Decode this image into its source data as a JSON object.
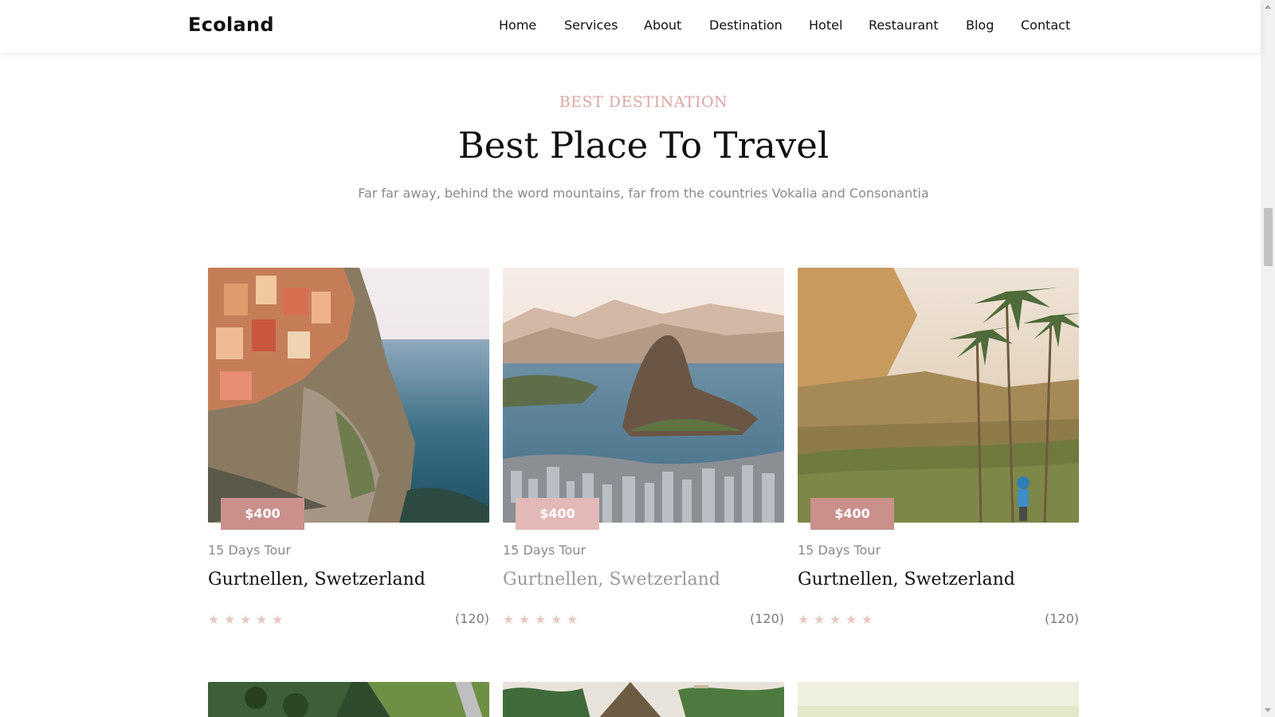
{
  "brand": "Ecoland",
  "nav": [
    "Home",
    "Services",
    "About",
    "Destination",
    "Hotel",
    "Restaurant",
    "Blog",
    "Contact"
  ],
  "section": {
    "subheading": "BEST DESTINATION",
    "title": "Best Place To Travel",
    "lead": "Far far away, behind the word mountains, far from the countries Vokalia and Consonantia"
  },
  "cards": [
    {
      "price": "$400",
      "duration": "15 Days Tour",
      "place": "Gurtnellen, Swetzerland",
      "rating": 5,
      "reviews": "(120)"
    },
    {
      "price": "$400",
      "duration": "15 Days Tour",
      "place": "Gurtnellen, Swetzerland",
      "rating": 5,
      "reviews": "(120)"
    },
    {
      "price": "$400",
      "duration": "15 Days Tour",
      "place": "Gurtnellen, Swetzerland",
      "rating": 5,
      "reviews": "(120)"
    }
  ],
  "colors": {
    "accent": "#c9908c",
    "accent_light": "#e2b9b7",
    "star": "#e6c7c3",
    "muted_text": "#8a8a8a",
    "place_text": "#111111",
    "place_text_muted": "#9a9a9a"
  },
  "icons": {
    "rating": "star-icon"
  }
}
